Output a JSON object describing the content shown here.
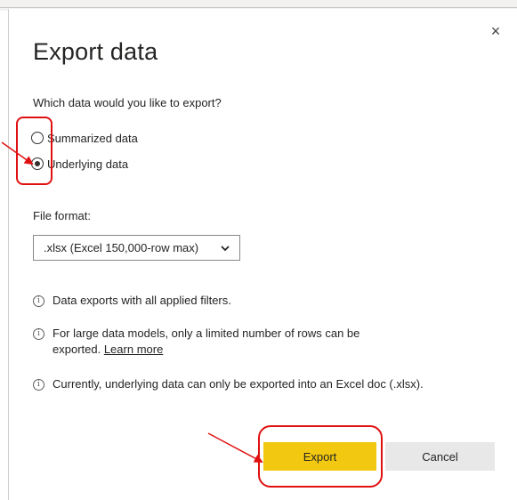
{
  "dialog": {
    "title": "Export data",
    "close_glyph": "×",
    "question": "Which data would you like to export?",
    "options": [
      {
        "label": "Summarized data",
        "checked": false
      },
      {
        "label": "Underlying data",
        "checked": true
      }
    ],
    "file_format_label": "File format:",
    "file_format_value": ".xlsx (Excel 150,000-row max)",
    "notes": {
      "note1": "Data exports with all applied filters.",
      "note2_line1": "For large data models, only a limited number of rows can be",
      "note2_line2": "exported.",
      "note2_link": "Learn more",
      "note3": "Currently, underlying data can only be exported into an Excel doc (.xlsx)."
    },
    "info_glyph": "i",
    "export_label": "Export",
    "cancel_label": "Cancel"
  },
  "annotations": {
    "color": "#e01010",
    "highlight_targets": [
      "radio-buttons",
      "export-button"
    ]
  },
  "colors": {
    "export_button": "#f2c811",
    "cancel_button": "#e8e8e8"
  }
}
